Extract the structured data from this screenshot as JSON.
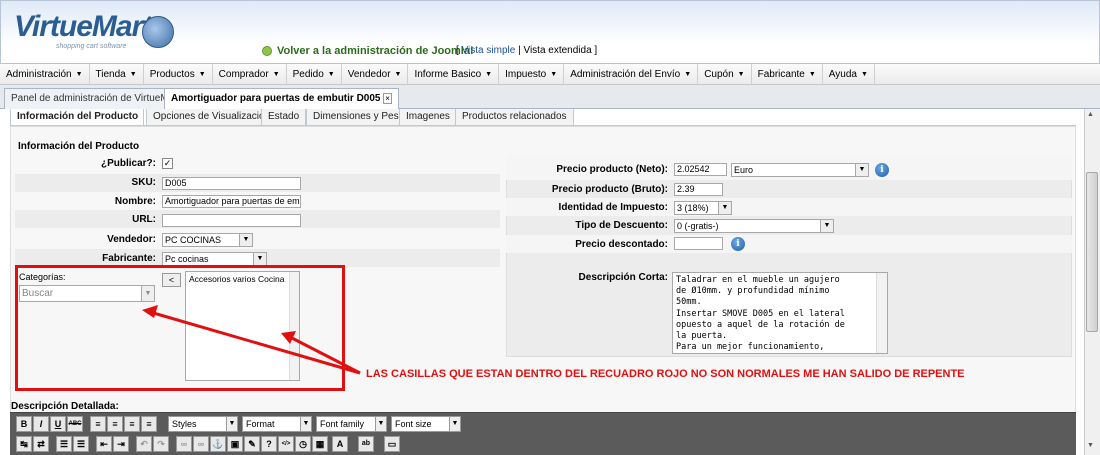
{
  "header": {
    "logo_text": "VirtueMart",
    "logo_subtitle": "shopping cart software",
    "joomla_link": "Volver a la administración de Joomla!",
    "view_simple": "Vista simple",
    "view_extended": "Vista extendida"
  },
  "menu": [
    {
      "label": "Administración"
    },
    {
      "label": "Tienda"
    },
    {
      "label": "Productos"
    },
    {
      "label": "Comprador"
    },
    {
      "label": "Pedido"
    },
    {
      "label": "Vendedor"
    },
    {
      "label": "Informe Basico"
    },
    {
      "label": "Impuesto"
    },
    {
      "label": "Administración del Envío"
    },
    {
      "label": "Cupón"
    },
    {
      "label": "Fabricante"
    },
    {
      "label": "Ayuda"
    }
  ],
  "top_tabs": {
    "panel": "Panel de administración de VirtueMart",
    "product": "Amortiguador para puertas de embutir D005",
    "close": "×"
  },
  "sub_tabs": [
    "Información del Producto",
    "Opciones de Visualización",
    "Estado",
    "Dimensiones y Peso",
    "Imagenes",
    "Productos relacionados"
  ],
  "product_info": {
    "section_title": "Información del Producto",
    "publish_label": "¿Publicar?:",
    "publish_check": "✓",
    "sku_label": "SKU:",
    "sku_value": "D005",
    "name_label": "Nombre:",
    "name_value": "Amortiguador para puertas de embut",
    "url_label": "URL:",
    "url_value": "",
    "vendor_label": "Vendedor:",
    "vendor_value": "PC COCINAS",
    "manufacturer_label": "Fabricante:",
    "manufacturer_value": "Pc cocinas",
    "categories_label": "Categorías:",
    "categories_search": "Buscar",
    "move_button": "<",
    "selected_category": "Accesorios varios Cocina"
  },
  "pricing": {
    "net_label": "Precio producto (Neto):",
    "net_value": "2.02542",
    "currency": "Euro",
    "gross_label": "Precio producto (Bruto):",
    "gross_value": "2.39",
    "tax_label": "Identidad de Impuesto:",
    "tax_value": "3 (18%)",
    "discount_type_label": "Tipo de Descuento:",
    "discount_type_value": "0 (-gratis-)",
    "discounted_label": "Precio descontado:",
    "discounted_value": "",
    "info_icon_glyph": "i",
    "short_desc_label": "Descripción Corta:",
    "short_desc_text": "Taladrar en el mueble un agujero\nde Ø10mm. y profundidad mínimo\n50mm.\nInsertar SMOVE D005 en el lateral\nopuesto a aquel de la rotación de\nla puerta.\nPara un mejor funcionamiento,"
  },
  "annotation": "LAS CASILLAS QUE ESTAN DENTRO DEL RECUADRO ROJO NO SON NORMALES ME HAN SALIDO DE REPENTE",
  "detailed": {
    "label": "Descripción Detallada:",
    "bold": "B",
    "italic": "I",
    "underline": "U",
    "strike": "ABC",
    "styles": "Styles",
    "format": "Format",
    "font_family": "Font family",
    "font_size": "Font size"
  },
  "colors": {
    "annotation": "#e01010",
    "link": "#1b4f9c",
    "joomla": "#2a6c1c"
  }
}
